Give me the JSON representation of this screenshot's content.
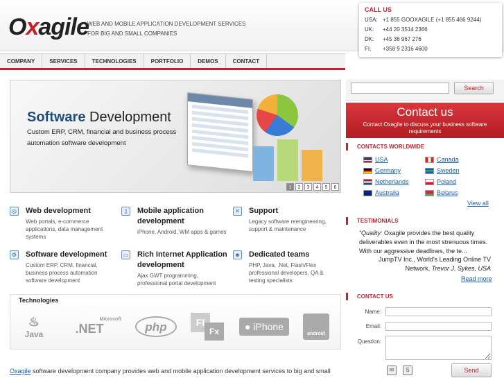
{
  "header": {
    "logo_prefix": "O",
    "logo_x": "x",
    "logo_rest": "agile",
    "tagline_1": "WEB AND MOBILE APPLICATION DEVELOPMENT SERVICES",
    "tagline_2": "FOR BIG AND SMALL COMPANIES"
  },
  "callus": {
    "title": "CALL US",
    "phones": [
      {
        "country": "USA:",
        "number": "+1 855 GOOXAGILE (+1 855 466 9244)"
      },
      {
        "country": "UK:",
        "number": "+44 20 3514 2366"
      },
      {
        "country": "DK:",
        "number": "+45 36 967 276"
      },
      {
        "country": "FI:",
        "number": "+358 9 2316 4600"
      }
    ]
  },
  "nav": [
    "COMPANY",
    "SERVICES",
    "TECHNOLOGIES",
    "PORTFOLIO",
    "DEMOS",
    "CONTACT"
  ],
  "hero": {
    "title_bold": "Software",
    "title_rest": " Development",
    "description": "Custom ERP, CRM, financial and business process automation software development",
    "pages": [
      "1",
      "2",
      "3",
      "4",
      "5",
      "6"
    ]
  },
  "services": [
    {
      "title": "Web development",
      "desc": "Web portals, e-commerce applications, data management systems",
      "icon": "web-icon"
    },
    {
      "title": "Mobile application development",
      "desc": "iPhone, Android, WM apps & games",
      "icon": "mobile-icon"
    },
    {
      "title": "Support",
      "desc": "Legacy software reengineering, support & maintenance",
      "icon": "tools-icon"
    },
    {
      "title": "Software development",
      "desc": "Custom ERP, CRM, financial, business process automation software development",
      "icon": "software-icon"
    },
    {
      "title": "Rich Internet Application development",
      "desc": "Ajax GWT programming, professional portal development",
      "icon": "tv-icon"
    },
    {
      "title": "Dedicated teams",
      "desc": "PHP, Java, .Net, Flash/Flex professional developers, QA & testing specialists",
      "icon": "team-icon"
    }
  ],
  "technologies": {
    "title": "Technologies",
    "java": "Java",
    "net_small": "Microsoft",
    "net": ".NET",
    "php": "php",
    "fl": "Fl",
    "fx": "Fx",
    "iphone": "iPhone",
    "android": "android"
  },
  "bottom": {
    "link": "Oxagile",
    "text": " software development company provides web and mobile application development services to big and small"
  },
  "search": {
    "placeholder": "",
    "button": "Search"
  },
  "contact_banner": {
    "title": "Contact us",
    "subtitle": "Contact Oxagile to discuss your business software requirements"
  },
  "contacts_worldwide": {
    "title": "CONTACTS WORLDWIDE",
    "countries": [
      "USA",
      "Canada",
      "Germany",
      "Sweden",
      "Netherlands",
      "Poland",
      "Australia",
      "Belarus"
    ],
    "view_all": "View all"
  },
  "testimonials": {
    "title": "TESTIMONIALS",
    "quote_label": "“Quality:",
    "quote": " Oxagile provides the best quality deliverables even in the most strenuous times. With our aggressive deadlines, the te...",
    "author_line1": "JumpTV Inc., World's Leading Online TV",
    "author_line2_prefix": "Network, ",
    "author_name": "Trevor J. Sykes, USA",
    "read_more": "Read more"
  },
  "contact_form": {
    "title": "CONTACT US",
    "name_label": "Name:",
    "email_label": "Email:",
    "question_label": "Question:",
    "send": "Send"
  },
  "colors": {
    "brand_red": "#c8202b",
    "navy": "#1f3a5a",
    "link": "#1a5ea8"
  }
}
